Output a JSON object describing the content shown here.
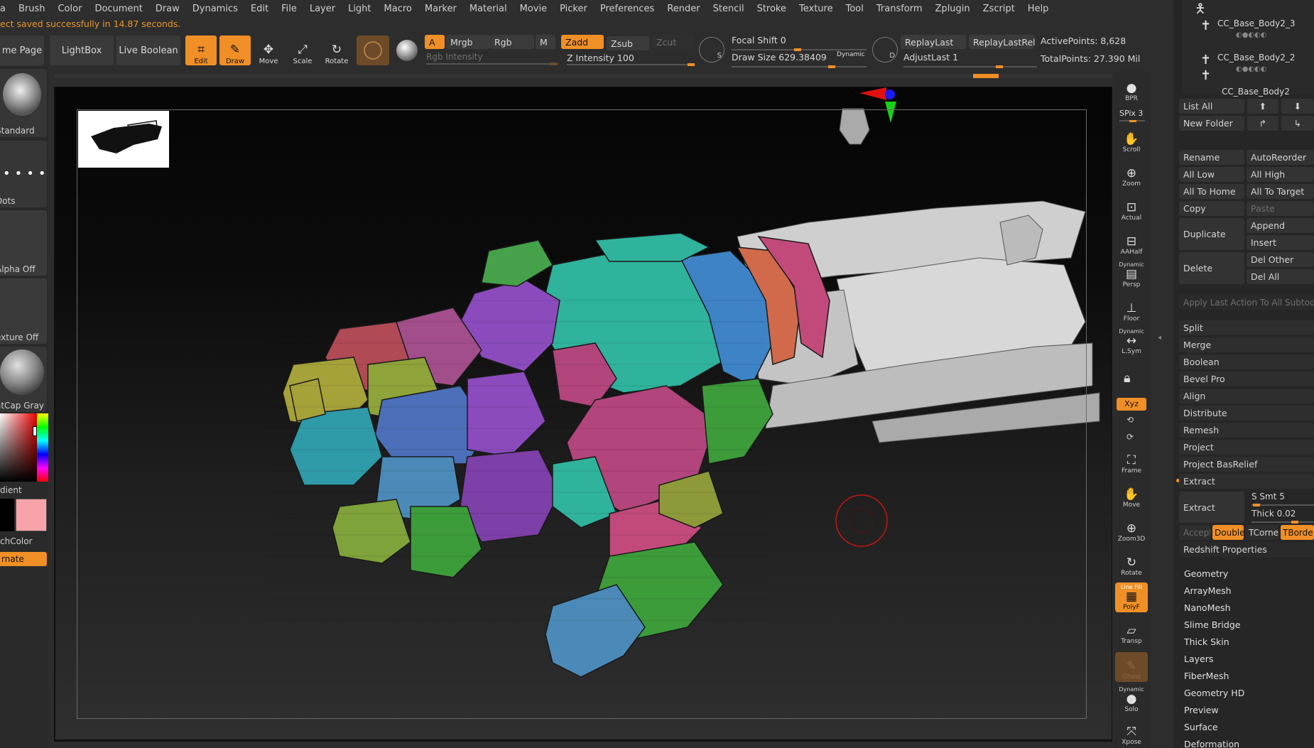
{
  "menu": [
    "a",
    "Brush",
    "Color",
    "Document",
    "Draw",
    "Dynamics",
    "Edit",
    "File",
    "Layer",
    "Light",
    "Macro",
    "Marker",
    "Material",
    "Movie",
    "Picker",
    "Preferences",
    "Render",
    "Stencil",
    "Stroke",
    "Texture",
    "Tool",
    "Transform",
    "Zplugin",
    "Zscript",
    "Help"
  ],
  "notice": "ect saved successfully in 14.87 seconds.",
  "toolbar": {
    "home": "me Page",
    "lightbox": "LightBox",
    "live_boolean": "Live Boolean",
    "edit": "Edit",
    "draw": "Draw",
    "move": "Move",
    "scale": "Scale",
    "rotate": "Rotate",
    "a": "A",
    "mrgb": "Mrgb",
    "rgb": "Rgb",
    "m": "M",
    "zadd": "Zadd",
    "zsub": "Zsub",
    "zcut": "Zcut",
    "rgb_intensity": "Rgb Intensity",
    "z_intensity": "Z Intensity 100",
    "focal_shift": "Focal Shift 0",
    "draw_size": "Draw Size 629.38409",
    "dynamic": "Dynamic",
    "replay_last": "ReplayLast",
    "replay_last_rel": "ReplayLastRel",
    "adjust_last": "AdjustLast 1",
    "active_points": "ActivePoints: 8,628",
    "total_points": "TotalPoints: 27.390 Mil",
    "s": "S",
    "d": "D"
  },
  "leftshelf": [
    "Standard",
    "Dots",
    "Alpha Off",
    "exture Off",
    "atCap Gray",
    "dient",
    "chColor",
    "rnate"
  ],
  "rightshelf": [
    "BPR",
    "SPix 3",
    "Scroll",
    "Zoom",
    "Actual",
    "AAHalf",
    "Persp",
    "Floor",
    "L.Sym",
    "Xyz",
    "Frame",
    "Move",
    "Zoom3D",
    "Rotate",
    "PolyF",
    "Transp",
    "Ghost",
    "Solo",
    "Xpose"
  ],
  "rightshelf_extra": {
    "dynamic": "Dynamic",
    "linefill": "Line Fill"
  },
  "subtools": [
    "CC_Base_Body2_3",
    "CC_Base_Body2_2",
    "CC_Base_Body2"
  ],
  "panel": {
    "list_all": "List All",
    "new_folder": "New Folder",
    "rename": "Rename",
    "autoreorder": "AutoReorder",
    "all_low": "All Low",
    "all_high": "All High",
    "all_to_home": "All To Home",
    "all_to_target": "All To Target",
    "copy": "Copy",
    "paste": "Paste",
    "duplicate": "Duplicate",
    "append": "Append",
    "insert": "Insert",
    "delete": "Delete",
    "del_other": "Del Other",
    "del_all": "Del All",
    "apply_last": "Apply Last Action To All Subtools",
    "actions": [
      "Split",
      "Merge",
      "Boolean",
      "Bevel Pro",
      "Align",
      "Distribute",
      "Remesh",
      "Project",
      "Project BasRelief"
    ],
    "extract_header": "Extract",
    "extract": "Extract",
    "s_smt": "S Smt 5",
    "thick": "Thick 0.02",
    "accept": "Accept",
    "double": "Double",
    "tcorne": "TCorne",
    "tborde": "TBorde",
    "redshift": "Redshift Properties",
    "sections": [
      "Geometry",
      "ArrayMesh",
      "NanoMesh",
      "Slime Bridge",
      "Thick Skin",
      "Layers",
      "FiberMesh",
      "Geometry HD",
      "Preview",
      "Surface",
      "Deformation"
    ]
  },
  "colors": {
    "accent": "#f08f26",
    "panel": "#262626",
    "button": "#333333"
  }
}
